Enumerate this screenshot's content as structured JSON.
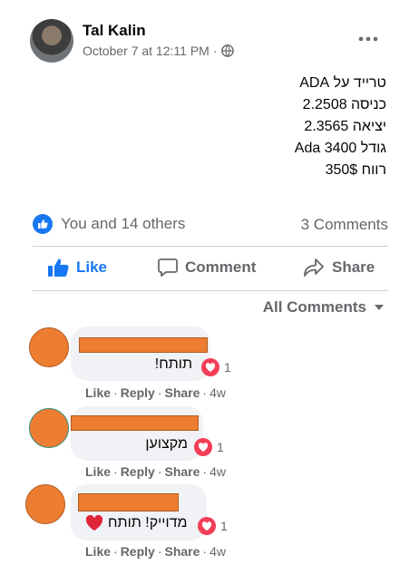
{
  "post": {
    "author": "Tal Kalin",
    "timestamp": "October 7 at 12:11 PM",
    "separator": "·",
    "lines": [
      "טרייד על ADA",
      "כניסה 2.2508",
      "יציאה 2.3565",
      "גודל 3400 Ada",
      "רווח 350$"
    ]
  },
  "summary": {
    "reactions_text": "You and 14 others",
    "comments_count": "3 Comments"
  },
  "actions": {
    "like": "Like",
    "comment": "Comment",
    "share": "Share"
  },
  "filter": {
    "label": "All Comments"
  },
  "comments": [
    {
      "text": "תותח!",
      "reaction_count": "1",
      "like": "Like",
      "reply": "Reply",
      "share": "Share",
      "age": "4w"
    },
    {
      "text": "מקצוען",
      "reaction_count": "1",
      "like": "Like",
      "reply": "Reply",
      "share": "Share",
      "age": "4w"
    },
    {
      "text": "מדוייק! תותח",
      "reaction_count": "1",
      "like": "Like",
      "reply": "Reply",
      "share": "Share",
      "age": "4w"
    }
  ],
  "colors": {
    "accent": "#1877f2",
    "love": "#f33e58",
    "redaction": "#ed7d31",
    "secondary_text": "#65676b"
  }
}
